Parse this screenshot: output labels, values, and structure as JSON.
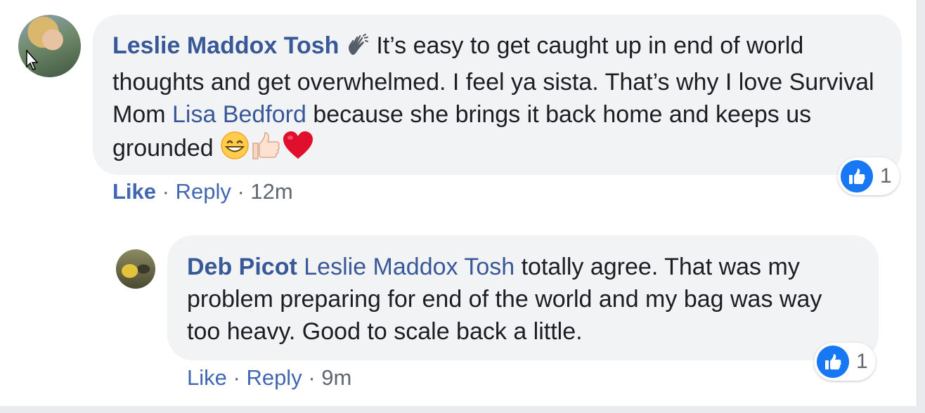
{
  "comments": [
    {
      "author": "Leslie Maddox Tosh",
      "text_1": " It’s easy to get caught up in end of world thoughts and get overwhelmed. I feel ya sista. That’s why I love Survival Mom ",
      "mention": "Lisa Bedford",
      "text_2": " because she brings it back home and keeps us grounded ",
      "like_label": "Like",
      "reply_label": "Reply",
      "time": "12m",
      "reaction_count": "1"
    },
    {
      "author": "Deb Picot",
      "mention": "Leslie Maddox Tosh",
      "text_1": " totally agree. That was my problem preparing for end of the world and my bag was way too heavy. Good to scale back a little.",
      "like_label": "Like",
      "reply_label": "Reply",
      "time": "9m",
      "reaction_count": "1"
    }
  ],
  "separator": " · ",
  "icons": [
    "waving-hand-icon",
    "grinning-face-icon",
    "thumbs-up-icon",
    "heart-icon",
    "like-reaction-icon",
    "mouse-cursor-icon"
  ],
  "colors": {
    "link": "#385898",
    "bubble": "#f2f3f5",
    "like_blue": "#1877f2"
  }
}
